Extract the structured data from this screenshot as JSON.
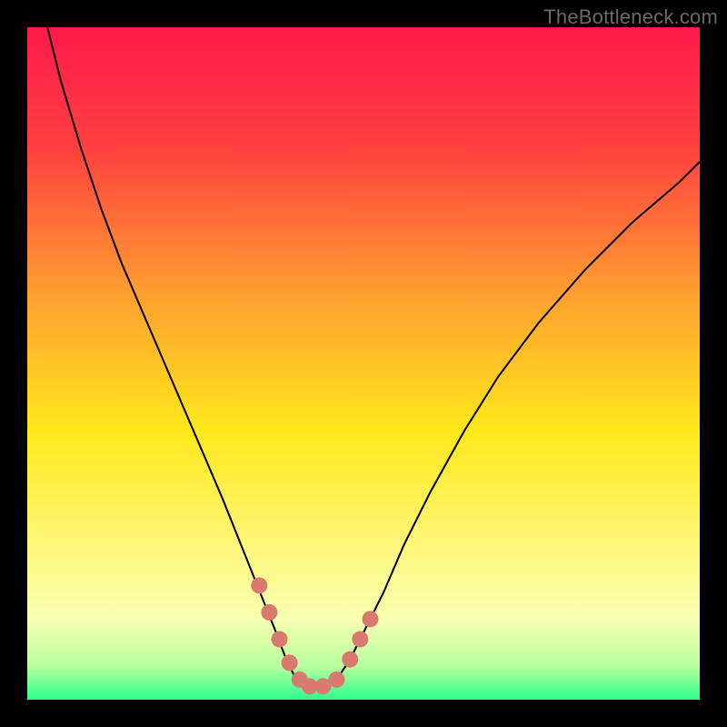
{
  "watermark": "TheBottleneck.com",
  "chart_data": {
    "type": "line",
    "title": "",
    "xlabel": "",
    "ylabel": "",
    "xlim": [
      0,
      100
    ],
    "ylim": [
      0,
      100
    ],
    "background_gradient": {
      "stops": [
        {
          "offset": 0,
          "color": "#ff1a4b"
        },
        {
          "offset": 18,
          "color": "#ff4040"
        },
        {
          "offset": 40,
          "color": "#ffa030"
        },
        {
          "offset": 60,
          "color": "#ffe81a"
        },
        {
          "offset": 78,
          "color": "#fff780"
        },
        {
          "offset": 88,
          "color": "#f7ffb0"
        },
        {
          "offset": 95,
          "color": "#b8ff9e"
        },
        {
          "offset": 100,
          "color": "#2bff8c"
        }
      ]
    },
    "series": [
      {
        "name": "bottleneck-curve",
        "color": "#000000",
        "width": 2.0,
        "x": [
          3,
          5,
          8,
          11,
          14,
          17,
          20,
          23,
          26,
          29,
          31,
          33,
          35,
          37,
          38.5,
          40,
          42,
          44,
          46,
          48,
          50,
          53,
          56,
          60,
          65,
          70,
          76,
          83,
          90,
          97,
          100
        ],
        "y": [
          100,
          92,
          82,
          73,
          65,
          58,
          51,
          44,
          37,
          30,
          25,
          20,
          15,
          10,
          6,
          3,
          1.5,
          1.5,
          3,
          6,
          10,
          16,
          23,
          31,
          40,
          48,
          56,
          64,
          71,
          77,
          80
        ]
      }
    ],
    "highlight": {
      "name": "near-bottom-markers",
      "color": "#d87a6f",
      "radius": 9,
      "points": [
        {
          "x": 34.5,
          "y": 17
        },
        {
          "x": 36,
          "y": 13
        },
        {
          "x": 37.5,
          "y": 9
        },
        {
          "x": 39,
          "y": 5.5
        },
        {
          "x": 40.5,
          "y": 3
        },
        {
          "x": 42,
          "y": 2
        },
        {
          "x": 44,
          "y": 2
        },
        {
          "x": 46,
          "y": 3
        },
        {
          "x": 48,
          "y": 6
        },
        {
          "x": 49.5,
          "y": 9
        },
        {
          "x": 51,
          "y": 12
        }
      ]
    }
  }
}
